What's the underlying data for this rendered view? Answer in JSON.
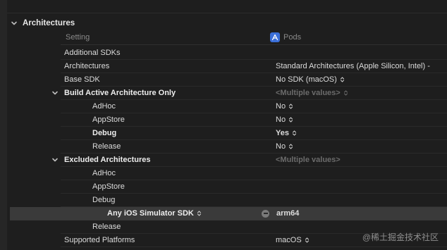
{
  "section": {
    "title": "Architectures"
  },
  "columns": {
    "setting": "Setting",
    "pods": "Pods"
  },
  "rows": [
    {
      "label": "Additional SDKs",
      "value": "",
      "bold": false,
      "level": 0
    },
    {
      "label": "Architectures",
      "value": "Standard Architectures (Apple Silicon, Intel)  -",
      "bold": false,
      "level": 0
    },
    {
      "label": "Base SDK",
      "value": "No SDK (macOS)",
      "bold": false,
      "level": 0,
      "stepper": true
    },
    {
      "label": "Build Active Architecture Only",
      "value": "<Multiple values>",
      "bold": true,
      "level": 0,
      "disclosure": "open",
      "multi": true,
      "stepper": true
    },
    {
      "label": "AdHoc",
      "value": "No",
      "bold": false,
      "level": 1,
      "stepper": true
    },
    {
      "label": "AppStore",
      "value": "No",
      "bold": false,
      "level": 1,
      "stepper": true
    },
    {
      "label": "Debug",
      "value": "Yes",
      "bold": true,
      "level": 1,
      "stepper": true
    },
    {
      "label": "Release",
      "value": "No",
      "bold": false,
      "level": 1,
      "stepper": true
    },
    {
      "label": "Excluded Architectures",
      "value": "<Multiple values>",
      "bold": true,
      "level": 0,
      "disclosure": "open",
      "multi": true
    },
    {
      "label": "AdHoc",
      "value": "",
      "bold": false,
      "level": 1
    },
    {
      "label": "AppStore",
      "value": "",
      "bold": false,
      "level": 1
    },
    {
      "label": "Debug",
      "value": "",
      "bold": false,
      "level": 1
    },
    {
      "label": "Any iOS Simulator SDK",
      "value": "arm64",
      "bold": true,
      "level": 2,
      "highlight": true,
      "stepper_label": true,
      "remove": true
    },
    {
      "label": "Release",
      "value": "",
      "bold": false,
      "level": 1
    },
    {
      "label": "Supported Platforms",
      "value": "macOS",
      "bold": false,
      "level": 0,
      "stepper": true
    }
  ],
  "watermark": "@稀土掘金技术社区"
}
